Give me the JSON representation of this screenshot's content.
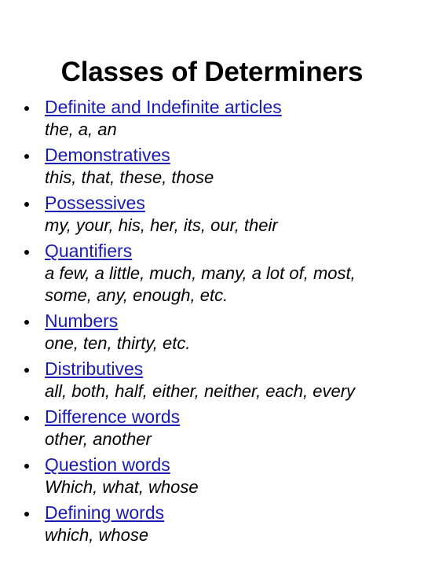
{
  "slide": {
    "title": "Classes of Determiners",
    "background_color": "#ffffff",
    "title_color": "#000000",
    "heading_color": "#1A1AB5",
    "example_color": "#000000",
    "bullet_glyph": "bullet-dot"
  },
  "bullets": [
    {
      "heading": "Definite and Indefinite articles",
      "examples": "the, a, an"
    },
    {
      "heading": "Demonstratives",
      "examples": "this, that, these, those"
    },
    {
      "heading": "Possessives",
      "examples": "my, your, his, her, its, our, their"
    },
    {
      "heading": "Quantifiers",
      "examples": "a few, a little, much, many, a lot of, most, some, any, enough, etc."
    },
    {
      "heading": "Numbers",
      "examples": "one, ten, thirty, etc."
    },
    {
      "heading": "Distributives",
      "examples": "all, both, half, either, neither, each, every"
    },
    {
      "heading": "Difference words",
      "examples": "other, another"
    },
    {
      "heading": "Question words",
      "examples": "Which, what, whose"
    },
    {
      "heading": "Defining words",
      "examples": "which, whose"
    }
  ]
}
